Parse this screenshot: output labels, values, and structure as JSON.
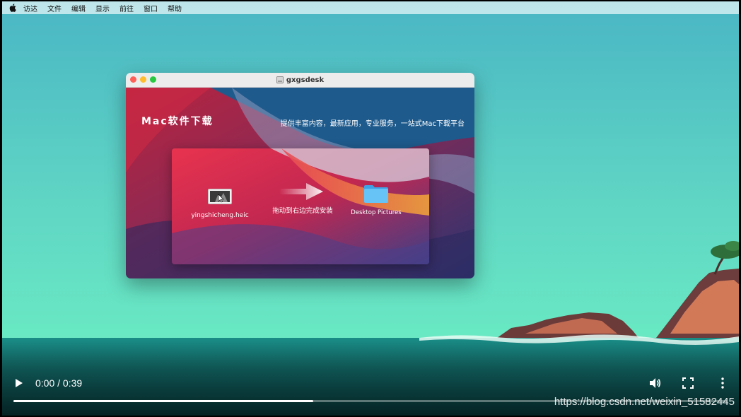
{
  "menubar": {
    "items": [
      {
        "label": "访达"
      },
      {
        "label": "文件"
      },
      {
        "label": "编辑"
      },
      {
        "label": "显示"
      },
      {
        "label": "前往"
      },
      {
        "label": "窗口"
      },
      {
        "label": "帮助"
      }
    ]
  },
  "window": {
    "title": "gxgsdesk",
    "brand": "Mac软件下载",
    "slogan": "提供丰富内容，最新应用，专业服务，一站式Mac下载平台",
    "source_file": "yingshicheng.heic",
    "drag_hint": "拖动到右边完成安装",
    "target_folder": "Desktop Pictures"
  },
  "video": {
    "time": "0:00 / 0:39",
    "progress": 0.42
  },
  "watermark": "https://blog.csdn.net/weixin_51582445",
  "colors": {
    "sea_top": "#57bfc3",
    "sea_bottom": "#63e5c0",
    "window_red": "#d21f43",
    "folder_blue": "#4fb4ee",
    "traffic_red": "#fe5f57",
    "traffic_yellow": "#febc2e",
    "traffic_green": "#28c840"
  },
  "icons": {
    "apple": "apple-logo-icon",
    "disk": "disk-icon",
    "play": "play-icon",
    "volume": "volume-icon",
    "fullscreen": "fullscreen-icon",
    "more": "more-vertical-icon"
  }
}
